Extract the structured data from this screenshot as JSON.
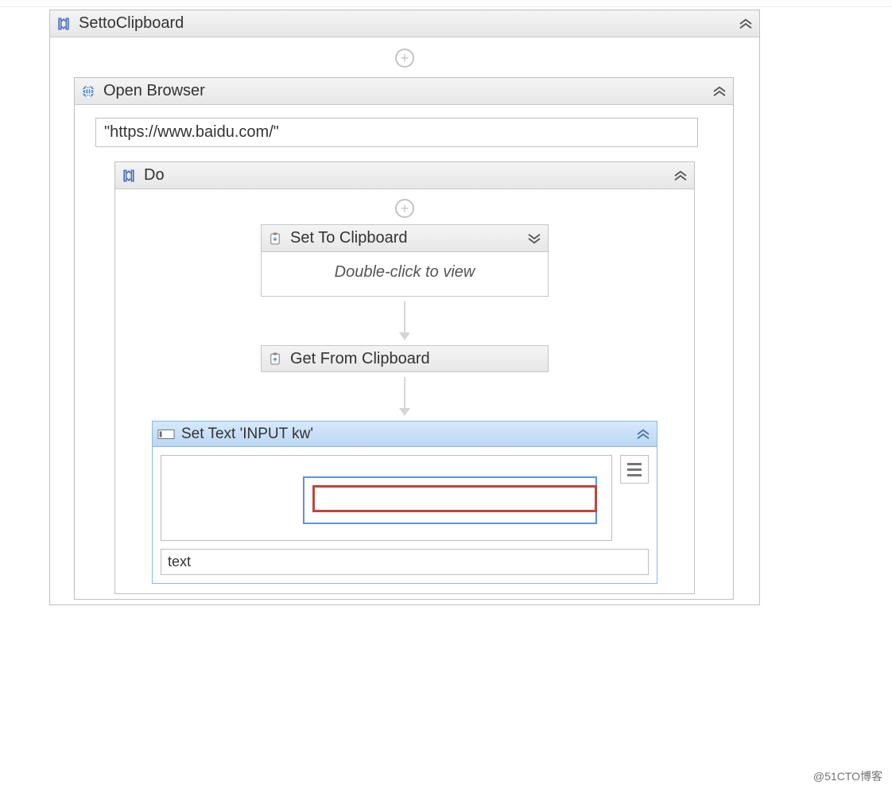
{
  "outer": {
    "title": "SettoClipboard"
  },
  "browser": {
    "title": "Open Browser",
    "url": "\"https://www.baidu.com/\""
  },
  "do": {
    "title": "Do"
  },
  "stc": {
    "title": "Set To Clipboard",
    "hint": "Double-click to view"
  },
  "gfc": {
    "title": "Get From Clipboard"
  },
  "settext": {
    "title": "Set Text 'INPUT  kw'",
    "value": "text"
  },
  "watermark": "@51CTO博客"
}
